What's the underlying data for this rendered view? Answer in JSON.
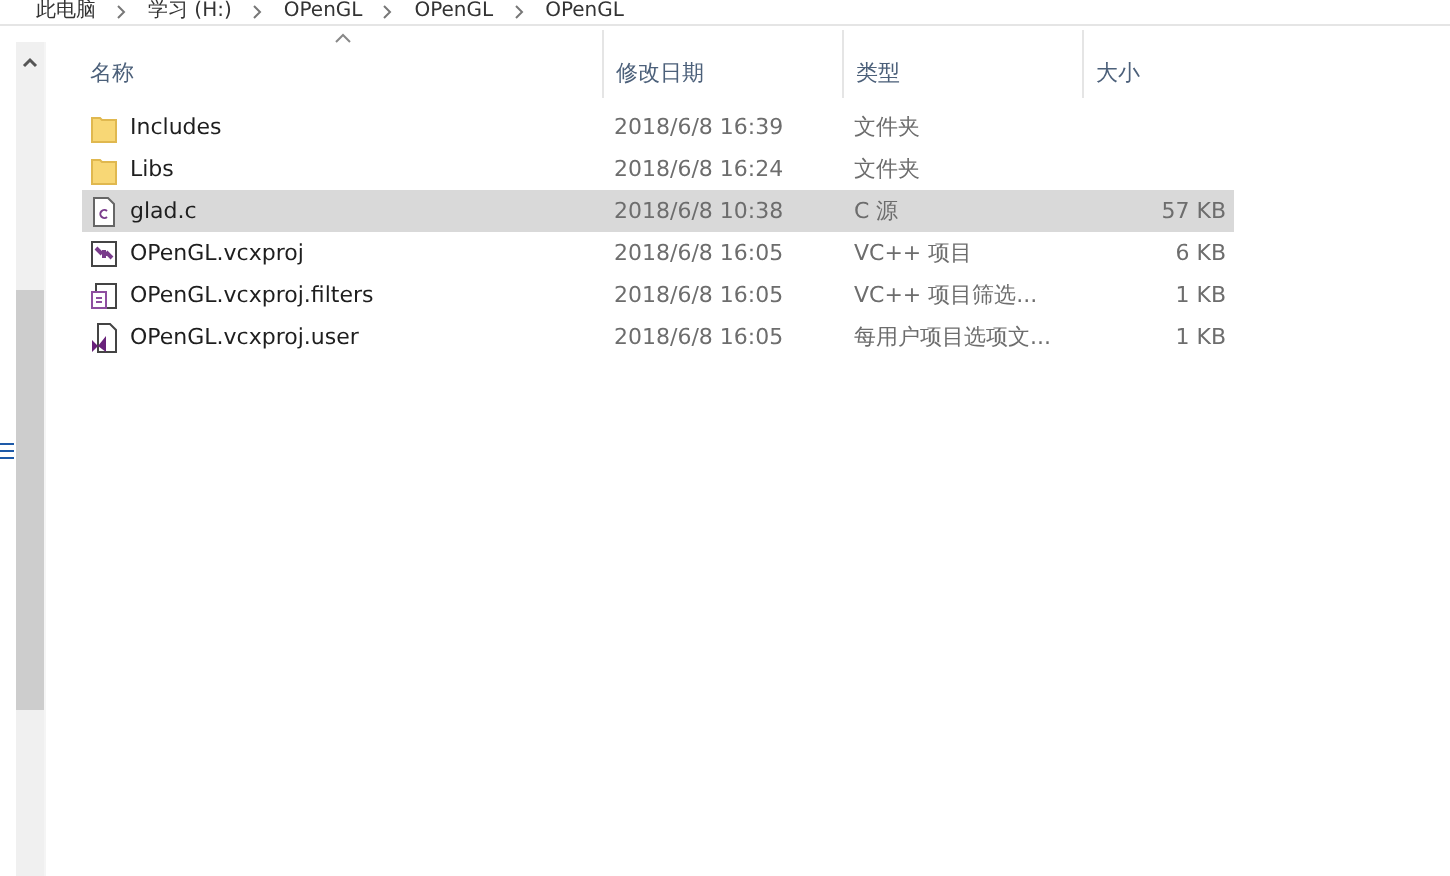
{
  "breadcrumb": [
    "此电脑",
    "学习 (H:)",
    "OPenGL",
    "OPenGL",
    "OPenGL"
  ],
  "table": {
    "columns": [
      {
        "label": "名称",
        "sorted": true
      },
      {
        "label": "修改日期",
        "sorted": false
      },
      {
        "label": "类型",
        "sorted": false
      },
      {
        "label": "大小",
        "sorted": false
      }
    ],
    "rows": [
      {
        "kind": "folder",
        "name": "Includes",
        "date": "2018/6/8 16:39",
        "type": "文件夹",
        "selected": false
      },
      {
        "kind": "folder",
        "name": "Libs",
        "date": "2018/6/8 16:24",
        "type": "文件夹",
        "selected": false
      },
      {
        "kind": "c-file",
        "name": "glad.c",
        "date": "2018/6/8 10:38",
        "type": "C 源",
        "size": "57 KB",
        "selected": true
      },
      {
        "kind": "project",
        "name": "OPenGL.vcxproj",
        "date": "2018/6/8 16:05",
        "type": "VC++ 项目",
        "size": "6 KB",
        "selected": false
      },
      {
        "kind": "filters",
        "name": "OPenGL.vcxproj.filters",
        "date": "2018/6/8 16:05",
        "type": "VC++ 项目筛选...",
        "size": "1 KB",
        "selected": false
      },
      {
        "kind": "user",
        "name": "OPenGL.vcxproj.user",
        "date": "2018/6/8 16:05",
        "type": "每用户项目选项文...",
        "size": "1 KB",
        "selected": false
      }
    ]
  }
}
